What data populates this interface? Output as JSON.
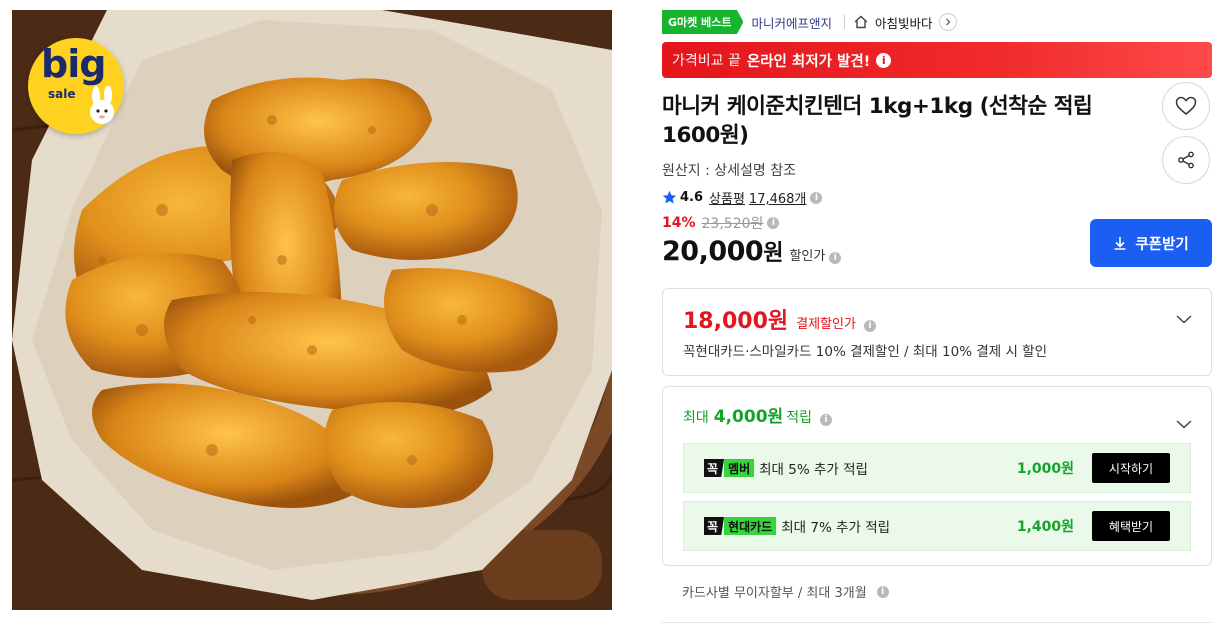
{
  "image": {
    "badge_big": "big",
    "badge_sale": "sale",
    "icon": "bigsale-bunny-badge"
  },
  "header": {
    "best_badge": "G마켓 베스트",
    "seller": "마니커에프앤지",
    "store_icon": "home-icon",
    "store_name": "아침빛바다"
  },
  "banner": {
    "lead": "가격비교 끝",
    "strong": "온라인 최저가 발견!",
    "info": "i"
  },
  "product": {
    "title": "마니커 케이준치킨텐더 1kg+1kg (선착순 적립 1600원)",
    "origin": "원산지 : 상세설명 참조",
    "rating": "4.6",
    "review_label": "상품평",
    "review_count": "17,468개",
    "discount_pct": "14%",
    "original_price": "23,520원",
    "price_number": "20,000",
    "price_unit": "원",
    "price_label": "할인가"
  },
  "buttons": {
    "coupon": "쿠폰받기",
    "like_icon": "heart-icon",
    "share_icon": "share-icon"
  },
  "payment": {
    "price": "18,000원",
    "label": "결제할인가",
    "desc": "꼭현대카드·스마일카드 10% 결제할인 / 최대 10% 결제 시 할인"
  },
  "rewards": {
    "head_prefix": "최대",
    "head_amount": "4,000원",
    "head_suffix": "적립",
    "rows": [
      {
        "tag_k": "꼭",
        "tag_n": "멤버",
        "text": "최대 5% 추가 적립",
        "amount": "1,000원",
        "action": "시작하기"
      },
      {
        "tag_k": "꼭",
        "tag_n": "현대카드",
        "text": "최대 7% 추가 적립",
        "amount": "1,400원",
        "action": "혜택받기"
      }
    ]
  },
  "installment": "카드사별 무이자할부 / 최대 3개월",
  "colors": {
    "accent_red": "#e4151c",
    "accent_green": "#15a32a",
    "coupon_blue": "#1a5ff2",
    "best_green": "#16b52d"
  }
}
